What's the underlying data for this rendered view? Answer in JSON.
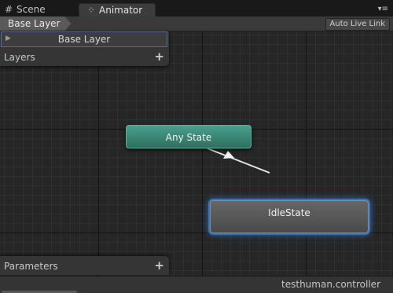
{
  "tabs": [
    {
      "label": "Scene",
      "icon": "grid-icon"
    },
    {
      "label": "Animator",
      "icon": "animator-icon"
    }
  ],
  "breadcrumb": {
    "label": "Base Layer"
  },
  "toolbar": {
    "auto_live_link": "Auto Live Link",
    "menu_icon": "dropdown-menu-icon"
  },
  "layers_panel": {
    "selected_layer": "Base Layer",
    "header": "Layers",
    "add": "+"
  },
  "parameters_panel": {
    "header": "Parameters",
    "add": "+"
  },
  "graph": {
    "states": [
      {
        "name": "Any State",
        "color": "#3f8f7d"
      },
      {
        "name": "IdleState",
        "color": "#555555",
        "selected": true
      }
    ],
    "transitions": [
      {
        "from": "Any State",
        "to": "IdleState"
      }
    ]
  },
  "status": {
    "file": "testhuman.controller"
  }
}
